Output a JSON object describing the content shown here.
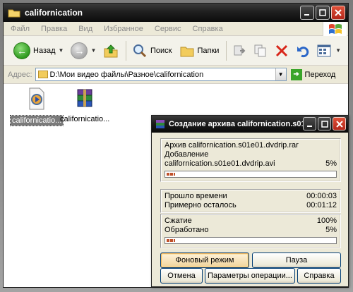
{
  "explorer": {
    "title": "californication",
    "menu": [
      "Файл",
      "Правка",
      "Вид",
      "Избранное",
      "Сервис",
      "Справка"
    ],
    "toolbar": {
      "back_label": "Назад",
      "search_label": "Поиск",
      "folders_label": "Папки"
    },
    "address": {
      "label": "Адрес:",
      "value": "D:\\Мои видео файлы\\Разное\\californication",
      "go_label": "Переход"
    },
    "files": [
      {
        "name": "californicatio...",
        "icon": "media-file-icon",
        "selected": true
      },
      {
        "name": "californicatio...",
        "icon": "winrar-archive-icon",
        "selected": false
      }
    ]
  },
  "dialog": {
    "title": "Создание архива californication.s01...",
    "archive_line": "Архив californication.s01e01.dvdrip.rar",
    "action_line": "Добавление",
    "current_file": "californication.s01e01.dvdrip.avi",
    "file_percent": "5%",
    "file_progress": 0.05,
    "elapsed_label": "Прошло времени",
    "elapsed_value": "00:00:03",
    "remaining_label": "Примерно осталось",
    "remaining_value": "00:01:12",
    "ratio_label": "Сжатие",
    "ratio_value": "100%",
    "processed_label": "Обработано",
    "processed_value": "5%",
    "total_progress": 0.05,
    "buttons": {
      "background": "Фоновый режим",
      "pause": "Пауза",
      "cancel": "Отмена",
      "options": "Параметры операции...",
      "help": "Справка"
    }
  }
}
